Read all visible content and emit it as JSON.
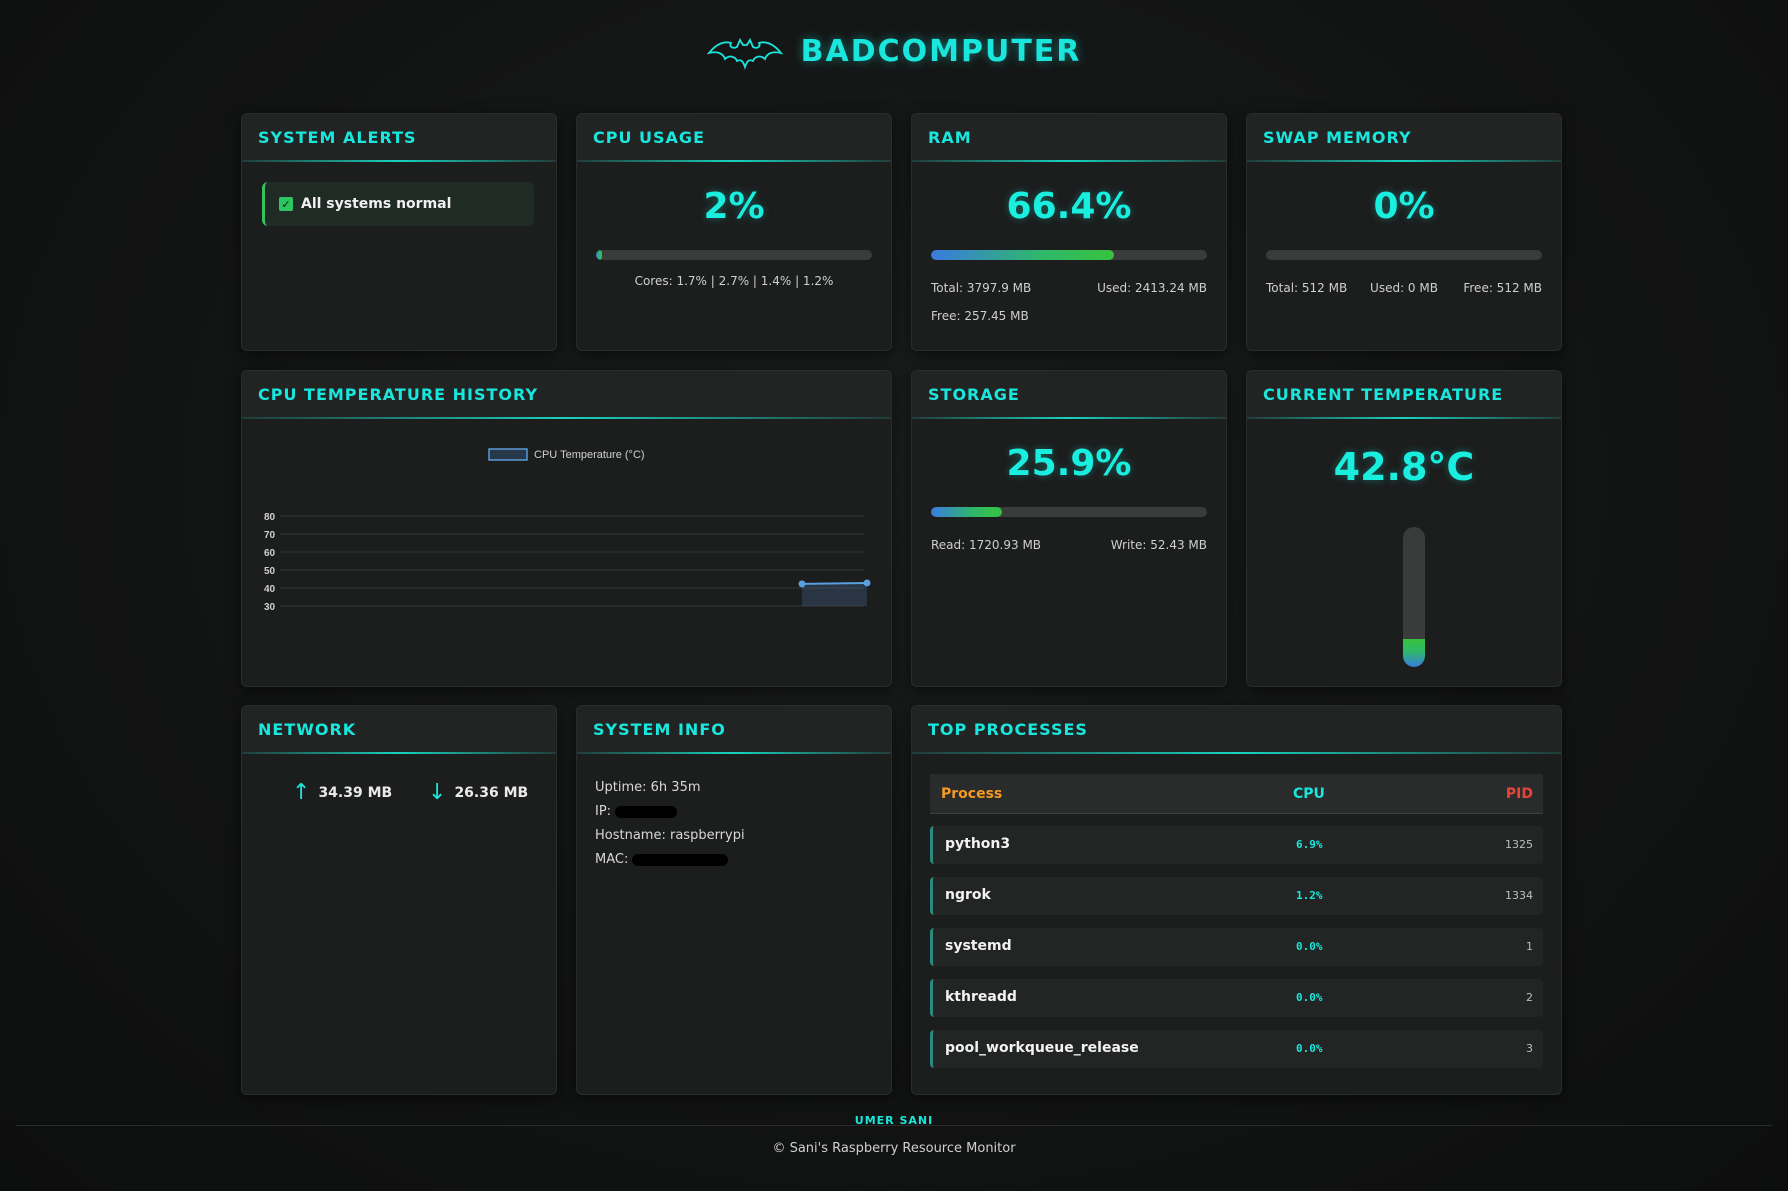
{
  "app": {
    "title": "BADCOMPUTER",
    "logo_icon": "bat-icon"
  },
  "alerts": {
    "title": "SYSTEM ALERTS",
    "message": "All systems normal"
  },
  "cpu": {
    "title": "CPU USAGE",
    "value": "2%",
    "percent": 2,
    "cores": "Cores: 1.7% | 2.7% | 1.4% | 1.2%"
  },
  "ram": {
    "title": "RAM",
    "value": "66.4%",
    "percent": 66.4,
    "total": "Total: 3797.9 MB",
    "used": "Used: 2413.24 MB",
    "free": "Free: 257.45 MB"
  },
  "swap": {
    "title": "SWAP MEMORY",
    "value": "0%",
    "percent": 0,
    "total": "Total: 512 MB",
    "used": "Used: 0 MB",
    "free": "Free: 512 MB"
  },
  "temp_history": {
    "title": "CPU TEMPERATURE HISTORY",
    "chart_data": {
      "type": "line",
      "series": [
        {
          "name": "CPU Temperature (°C)",
          "values": [
            42.3,
            42.8
          ]
        }
      ],
      "yticks": [
        "80",
        "70",
        "60",
        "50",
        "40",
        "30"
      ],
      "ylim": [
        30,
        80
      ],
      "legend": "top"
    }
  },
  "storage": {
    "title": "STORAGE",
    "value": "25.9%",
    "percent": 25.9,
    "read": "Read: 1720.93 MB",
    "write": "Write: 52.43 MB"
  },
  "current_temp": {
    "title": "CURRENT TEMPERATURE",
    "value": "42.8°C",
    "level_percent": 20
  },
  "network": {
    "title": "NETWORK",
    "upload": "34.39 MB",
    "download": "26.36 MB"
  },
  "sysinfo": {
    "title": "SYSTEM INFO",
    "uptime": "Uptime: 6h 35m",
    "ip_label": "IP:",
    "hostname": "Hostname: raspberrypi",
    "mac_label": "MAC:"
  },
  "processes": {
    "title": "TOP PROCESSES",
    "headers": {
      "process": "Process",
      "cpu": "CPU",
      "pid": "PID"
    },
    "header_colors": {
      "process": "#f59a23",
      "cpu": "#19e6dc",
      "pid": "#e8443a"
    },
    "rows": [
      {
        "name": "python3",
        "cpu": "6.9%",
        "pid": "1325"
      },
      {
        "name": "ngrok",
        "cpu": "1.2%",
        "pid": "1334"
      },
      {
        "name": "systemd",
        "cpu": "0.0%",
        "pid": "1"
      },
      {
        "name": "kthreadd",
        "cpu": "0.0%",
        "pid": "2"
      },
      {
        "name": "pool_workqueue_release",
        "cpu": "0.0%",
        "pid": "3"
      }
    ]
  },
  "footer": {
    "author": "UMER SANI",
    "copyright": "© Sani's Raspberry Resource Monitor"
  }
}
